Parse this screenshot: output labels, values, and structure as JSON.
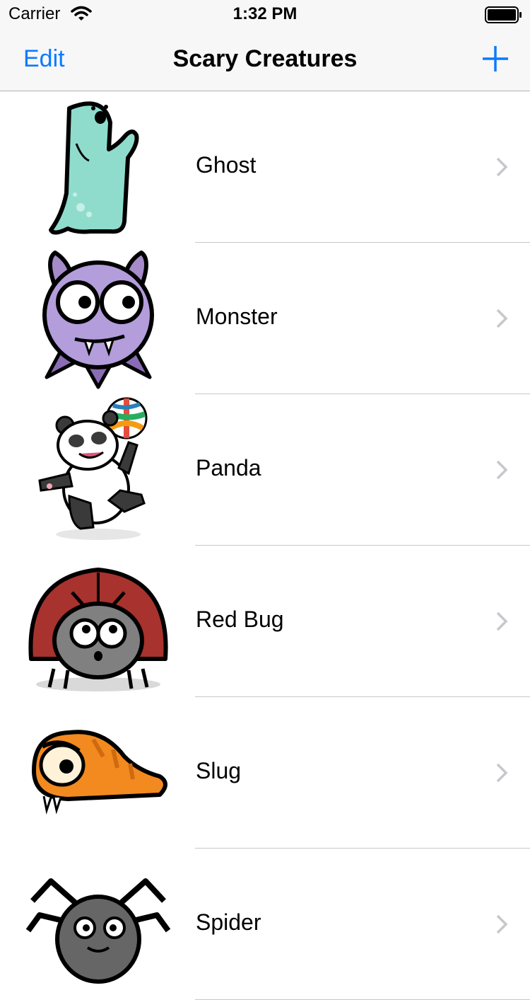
{
  "status_bar": {
    "carrier": "Carrier",
    "time": "1:32 PM"
  },
  "nav": {
    "edit_label": "Edit",
    "title": "Scary Creatures",
    "add_icon": "plus-icon"
  },
  "colors": {
    "accent": "#0a7aff",
    "separator": "#c8c7cc",
    "chevron": "#c7c7cc"
  },
  "creatures": [
    {
      "name": "Ghost"
    },
    {
      "name": "Monster"
    },
    {
      "name": "Panda"
    },
    {
      "name": "Red Bug"
    },
    {
      "name": "Slug"
    },
    {
      "name": "Spider"
    }
  ]
}
